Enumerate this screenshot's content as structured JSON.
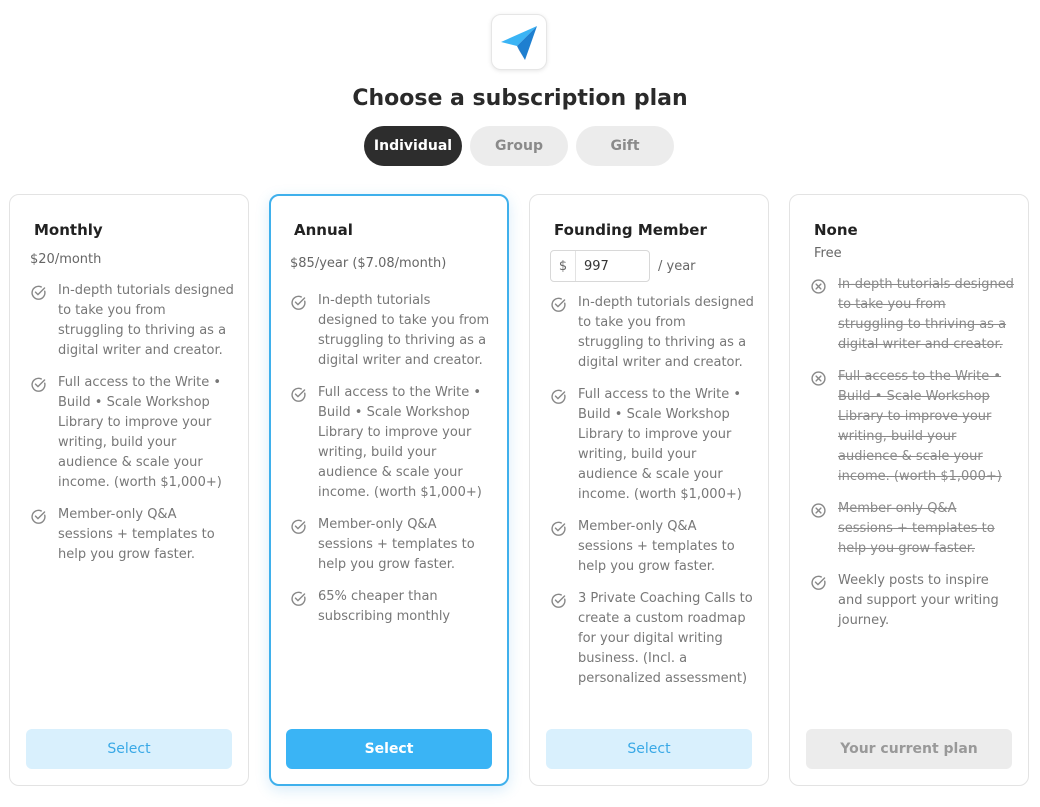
{
  "header": {
    "logo_icon": "paper-plane-icon",
    "title": "Choose a subscription plan"
  },
  "tabs": [
    {
      "label": "Individual",
      "active": true
    },
    {
      "label": "Group",
      "active": false
    },
    {
      "label": "Gift",
      "active": false
    }
  ],
  "colors": {
    "accent": "#3ab4f5",
    "accent_light": "#d9f0fd",
    "dark_tab": "#2d2d2d"
  },
  "plans": [
    {
      "name": "Monthly",
      "price": "$20/month",
      "features": [
        "In-depth tutorials designed to take you from struggling to thriving as a digital writer and creator.",
        "Full access to the Write • Build • Scale Workshop Library to improve your writing, build your audience & scale your income. (worth $1,000+)",
        "Member-only Q&A sessions + templates to help you grow faster."
      ],
      "button": "Select"
    },
    {
      "name": "Annual",
      "price": "$85/year ($7.08/month)",
      "features": [
        "In-depth tutorials designed to take you from struggling to thriving as a digital writer and creator.",
        "Full access to the Write • Build • Scale Workshop Library to improve your writing, build your audience & scale your income. (worth $1,000+)",
        "Member-only Q&A sessions + templates to help you grow faster.",
        "65% cheaper than subscribing monthly"
      ],
      "button": "Select"
    },
    {
      "name": "Founding Member",
      "currency": "$",
      "amount": "997",
      "per": "/ year",
      "features": [
        "In-depth tutorials designed to take you from struggling to thriving as a digital writer and creator.",
        "Full access to the Write • Build • Scale Workshop Library to improve your writing, build your audience & scale your income. (worth $1,000+)",
        "Member-only Q&A sessions + templates to help you grow faster.",
        "3 Private Coaching Calls to create a custom roadmap for your digital writing business. (Incl. a personalized assessment)"
      ],
      "button": "Select"
    },
    {
      "name": "None",
      "price": "Free",
      "features_excluded": [
        "In-depth tutorials designed to take you from struggling to thriving as a digital writer and creator.",
        "Full access to the Write • Build • Scale Workshop Library to improve your writing, build your audience & scale your income. (worth $1,000+)",
        "Member-only Q&A sessions + templates to help you grow faster."
      ],
      "features": [
        "Weekly posts to inspire and support your writing journey."
      ],
      "button": "Your current plan"
    }
  ]
}
